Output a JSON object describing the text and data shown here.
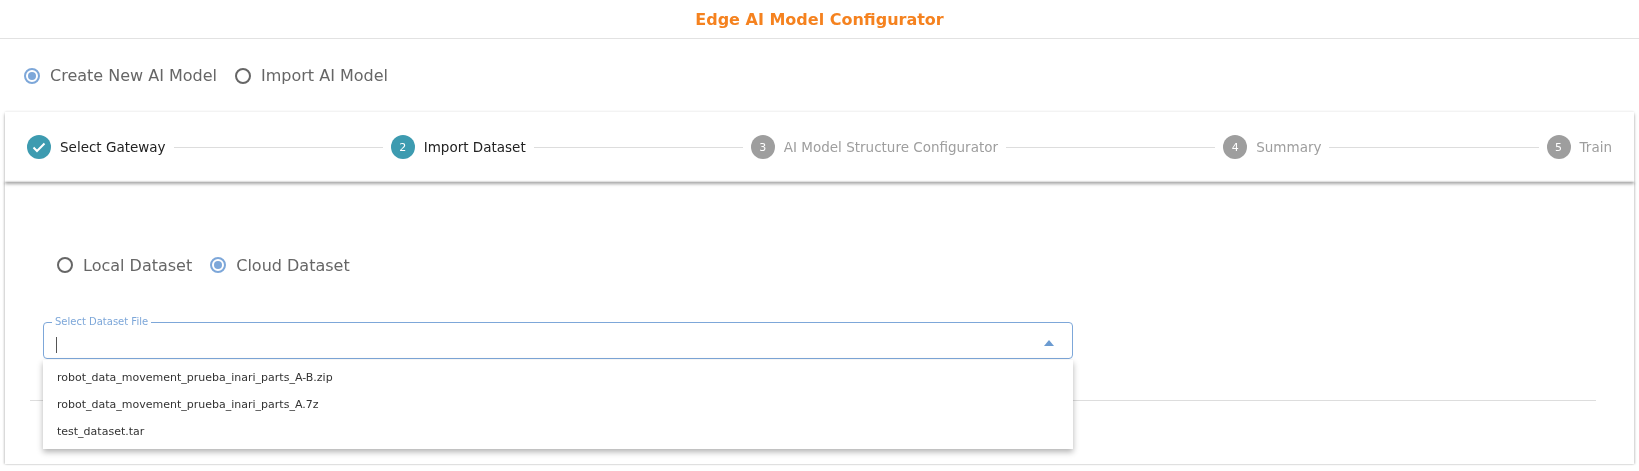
{
  "header": {
    "title": "Edge AI Model Configurator"
  },
  "mode_options": [
    {
      "label": "Create New AI Model",
      "selected": true
    },
    {
      "label": "Import AI Model",
      "selected": false
    }
  ],
  "stepper": {
    "steps": [
      {
        "label": "Select Gateway",
        "completed": true,
        "active": false
      },
      {
        "number": "2",
        "label": "Import Dataset",
        "completed": false,
        "active": true
      },
      {
        "number": "3",
        "label": "AI Model Structure Configurator",
        "completed": false,
        "active": false
      },
      {
        "number": "4",
        "label": "Summary",
        "completed": false,
        "active": false
      },
      {
        "number": "5",
        "label": "Train",
        "completed": false,
        "active": false
      }
    ]
  },
  "dataset_source": [
    {
      "label": "Local Dataset",
      "selected": false
    },
    {
      "label": "Cloud Dataset",
      "selected": true
    }
  ],
  "dataset_select": {
    "label": "Select Dataset File",
    "expanded": true,
    "options": [
      {
        "label": "robot_data_movement_prueba_inari_parts_A-B.zip"
      },
      {
        "label": "robot_data_movement_prueba_inari_parts_A.7z"
      },
      {
        "label": "test_dataset.tar"
      }
    ]
  }
}
